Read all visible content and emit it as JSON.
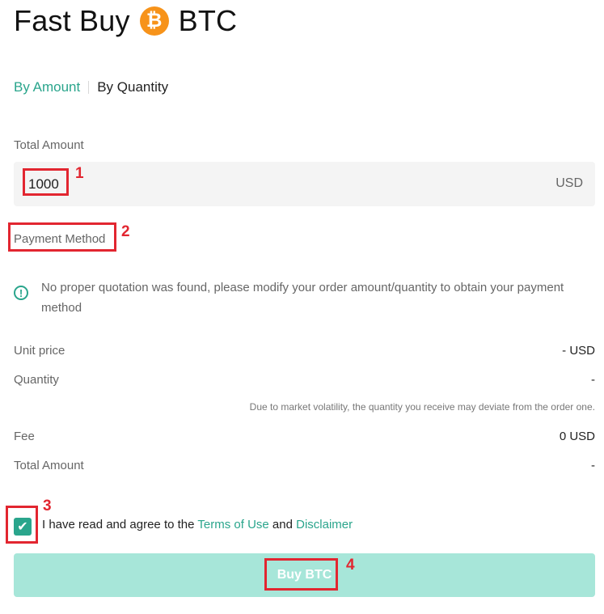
{
  "header": {
    "title_left": "Fast Buy",
    "title_right": "BTC",
    "coin_symbol": "₿"
  },
  "tabs": [
    {
      "label": "By Amount",
      "active": true
    },
    {
      "label": "By Quantity",
      "active": false
    }
  ],
  "form": {
    "total_amount_label": "Total Amount",
    "amount_value": "1000",
    "currency": "USD",
    "payment_method_label": "Payment Method",
    "notice": "No proper quotation was found, please modify your order amount/quantity to obtain your payment method"
  },
  "summary": {
    "unit_price_label": "Unit price",
    "unit_price_value": "- USD",
    "quantity_label": "Quantity",
    "quantity_value": "-",
    "note": "Due to market volatility, the quantity you receive may deviate from the order one.",
    "fee_label": "Fee",
    "fee_value": "0 USD",
    "total_label": "Total Amount",
    "total_value": "-"
  },
  "agreement": {
    "checked": true,
    "prefix": "I have read and agree to the",
    "terms": "Terms of Use",
    "and": "and",
    "disclaimer": "Disclaimer"
  },
  "buy_button": {
    "label": "Buy BTC"
  },
  "annotations": [
    "1",
    "2",
    "3",
    "4"
  ],
  "colors": {
    "accent": "#2aa58c",
    "button_bg": "#a7e6d9",
    "annotation": "#e22630",
    "coin": "#f7931a"
  }
}
